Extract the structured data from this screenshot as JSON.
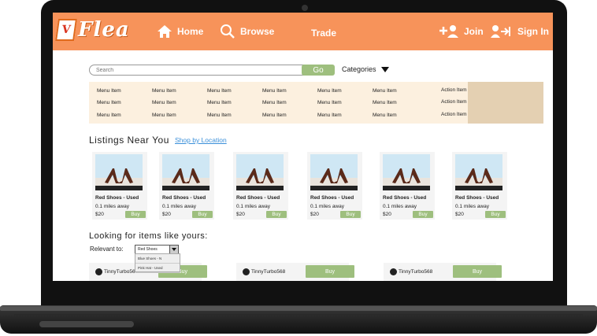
{
  "nav": {
    "logo_text": "Flea",
    "home": "Home",
    "browse": "Browse",
    "trade": "Trade",
    "join": "Join",
    "signin": "Sign In"
  },
  "search": {
    "placeholder": "Search",
    "go_label": "Go",
    "categories_label": "Categories"
  },
  "menu": {
    "rows": [
      [
        "Menu Item",
        "Menu Item",
        "Menu Item",
        "Menu Item",
        "Menu Item",
        "Menu Item",
        "Action Item"
      ],
      [
        "Menu Item",
        "Menu Item",
        "Menu Item",
        "Menu Item",
        "Menu Item",
        "Menu Item",
        "Action Item"
      ],
      [
        "Menu Item",
        "Menu Item",
        "Menu Item",
        "Menu Item",
        "Menu Item",
        "Menu Item",
        "Action Item"
      ]
    ]
  },
  "listings": {
    "title": "Listings Near You",
    "link": "Shop by Location",
    "cards": [
      {
        "title": "Red Shoes - Used",
        "distance": "0.1 miles away",
        "price": "$20",
        "buy": "Buy"
      },
      {
        "title": "Red Shoes - Used",
        "distance": "0.1 miles away",
        "price": "$20",
        "buy": "Buy"
      },
      {
        "title": "Red Shoes - Used",
        "distance": "0.1 miles away",
        "price": "$20",
        "buy": "Buy"
      },
      {
        "title": "Red Shoes - Used",
        "distance": "0.1 miles away",
        "price": "$20",
        "buy": "Buy"
      },
      {
        "title": "Red Shoes - Used",
        "distance": "0.1 miles away",
        "price": "$20",
        "buy": "Buy"
      },
      {
        "title": "Red Shoes - Used",
        "distance": "0.1 miles away",
        "price": "$20",
        "buy": "Buy"
      }
    ]
  },
  "looking": {
    "title": "Looking for items like yours:",
    "relevant_label": "Relevant to:",
    "select_value": "Red Shoes",
    "dropdown_options": [
      "Blue Shoes - N",
      "Pink Hat - Used"
    ],
    "cards": [
      {
        "user": "TinnyTurbo568",
        "buy": "Buy"
      },
      {
        "user": "TinnyTurbo568",
        "buy": "Buy"
      },
      {
        "user": "TinnyTurbo568",
        "buy": "Buy"
      }
    ]
  },
  "colors": {
    "nav_bg": "#f7935a",
    "menu_bg": "#fcf0df",
    "action_bg": "#e4d0b2",
    "button_green": "#9ebf7e",
    "link_blue": "#3a8fd9"
  }
}
